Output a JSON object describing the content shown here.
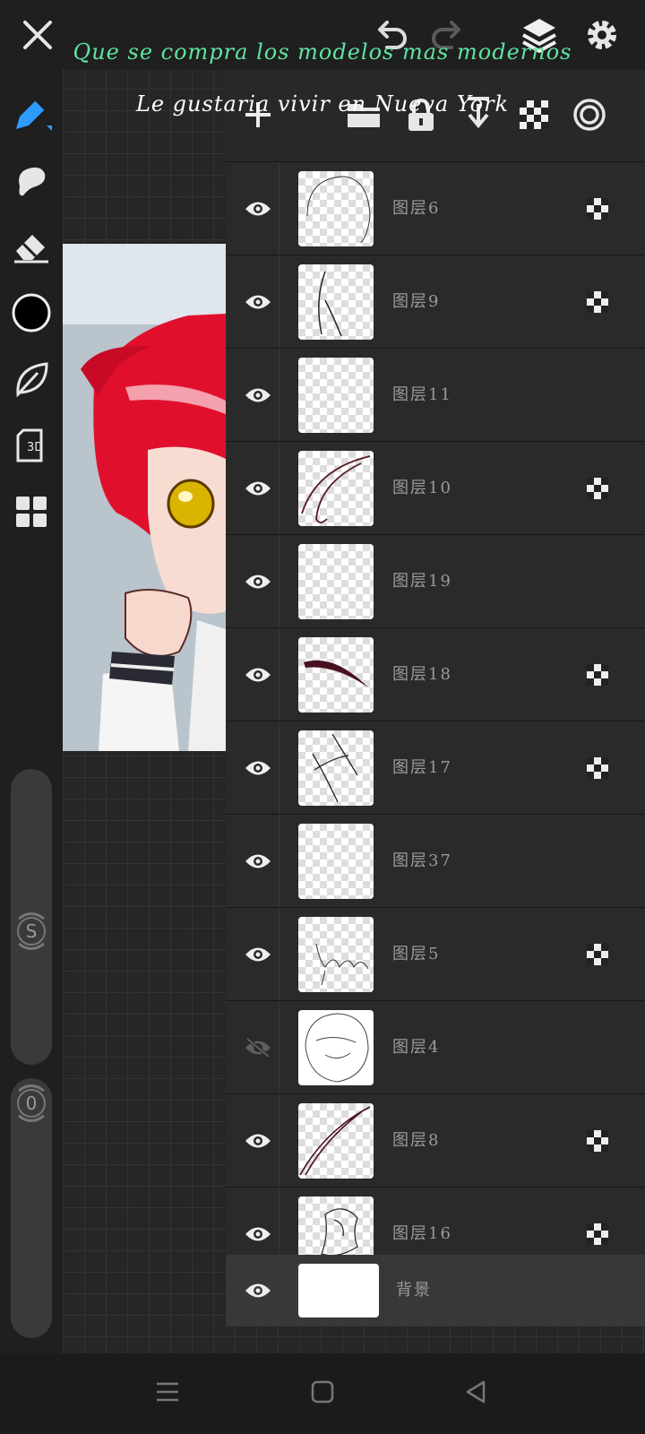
{
  "subtitles": {
    "line1": "Que se compra los modelos mas modernos",
    "line2": "Le gustaria vivir en Nueva York"
  },
  "colors": {
    "accent": "#2f9bff",
    "subtitle_line1": "#5fe3a1",
    "subtitle_line2": "#ffffff",
    "current_brush_color": "#000000"
  },
  "top_bar": {
    "icons": [
      "close-icon",
      "undo-icon",
      "redo-icon",
      "layers-icon",
      "settings-icon"
    ]
  },
  "left_toolbar": {
    "tools": [
      "pen-tool-icon",
      "smudge-tool-icon",
      "eraser-tool-icon",
      "color-picker",
      "shape-tool-icon",
      "3d-model-icon",
      "materials-icon"
    ],
    "model_3d_label": "3D",
    "size_slider_label": "S",
    "opacity_slider_label": "0"
  },
  "layer_panel": {
    "toolbar_icons": [
      "add-layer-icon",
      "folder-icon",
      "lock-icon",
      "merge-down-icon",
      "alpha-lock-icon",
      "clipping-icon"
    ],
    "layers": [
      {
        "name": "图层6",
        "visible": true,
        "alpha_locked": true
      },
      {
        "name": "图层9",
        "visible": true,
        "alpha_locked": true
      },
      {
        "name": "图层11",
        "visible": true,
        "alpha_locked": false
      },
      {
        "name": "图层10",
        "visible": true,
        "alpha_locked": true
      },
      {
        "name": "图层19",
        "visible": true,
        "alpha_locked": false
      },
      {
        "name": "图层18",
        "visible": true,
        "alpha_locked": true
      },
      {
        "name": "图层17",
        "visible": true,
        "alpha_locked": true
      },
      {
        "name": "图层37",
        "visible": true,
        "alpha_locked": false
      },
      {
        "name": "图层5",
        "visible": true,
        "alpha_locked": true
      },
      {
        "name": "图层4",
        "visible": false,
        "alpha_locked": false
      },
      {
        "name": "图层8",
        "visible": true,
        "alpha_locked": true
      },
      {
        "name": "图层16",
        "visible": true,
        "alpha_locked": true
      }
    ],
    "background_layer": {
      "name": "背景",
      "visible": true
    }
  },
  "nav_bar": {
    "icons": [
      "recents-icon",
      "home-icon",
      "back-icon"
    ]
  }
}
